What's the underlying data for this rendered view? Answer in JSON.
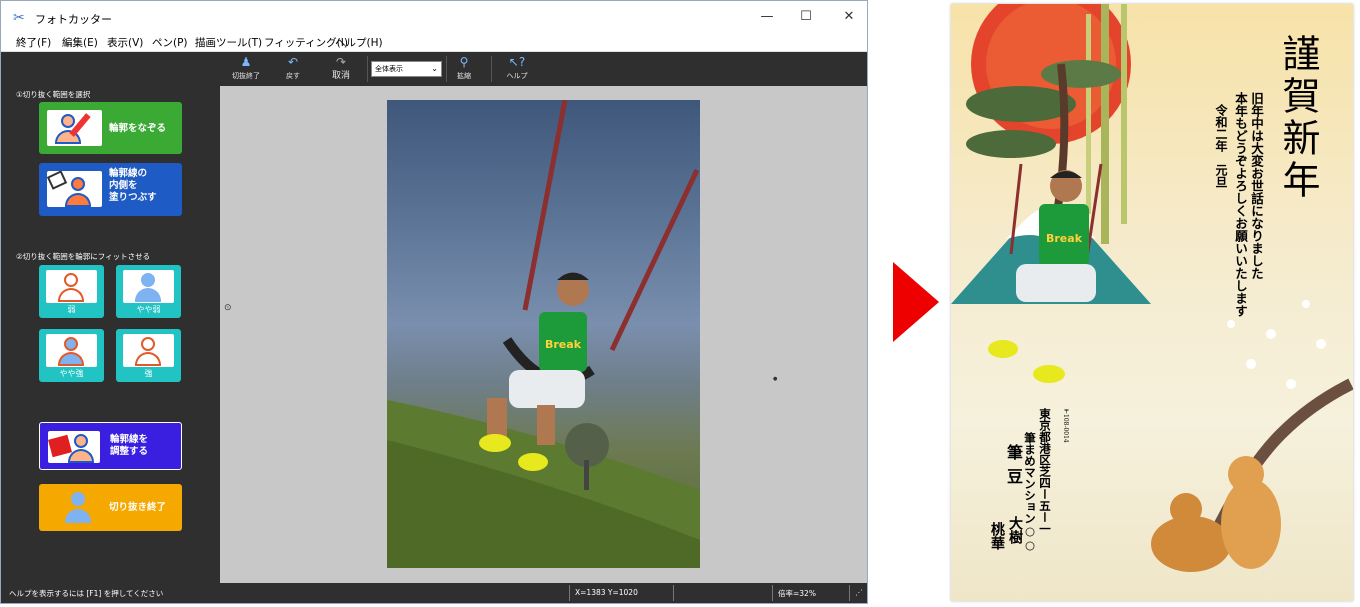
{
  "window": {
    "title": "フォトカッター",
    "controls": [
      "—",
      "☐",
      "✕"
    ]
  },
  "menu": [
    "終了(F)",
    "編集(E)",
    "表示(V)",
    "ペン(P)",
    "描画ツール(T)",
    "フィッティング(I)",
    "ヘルプ(H)"
  ],
  "toolbar": {
    "buttons": [
      {
        "label": "切抜終了",
        "icon": "person-cut-icon"
      },
      {
        "label": "戻す",
        "icon": "undo-icon"
      },
      {
        "label": "取消",
        "icon": "redo-icon"
      },
      {
        "label": "拡縮",
        "icon": "zoom-icon"
      },
      {
        "label": "ヘルプ",
        "icon": "help-icon"
      }
    ],
    "view_select": "全体表示"
  },
  "left_panel": {
    "section1": "①切り抜く範囲を選択",
    "trace_button": "輪郭をなぞる",
    "fill_button_lines": [
      "輪郭線の",
      "内側を",
      "塗りつぶす"
    ],
    "section2": "②切り抜く範囲を輪郭にフィットさせる",
    "fit_buttons": [
      "弱",
      "やや弱",
      "やや強",
      "強"
    ],
    "adjust_button_lines": [
      "輪郭線を",
      "調整する"
    ],
    "finish_button": "切り抜き終了"
  },
  "status": {
    "help_text": "ヘルプを表示するには [F1] を押してください",
    "coords": "X=1383 Y=1020",
    "zoom": "倍率=32%"
  },
  "card": {
    "greeting": "謹賀新年",
    "message_lines": [
      "旧年中は大変お世話になりました",
      "本年もどうぞよろしくお願いいたします"
    ],
    "date_line": "令和二年　元旦",
    "postal": "〒108-0014",
    "address": "東京都港区芝四ー五ー一",
    "building": "筆まめマンション○○",
    "family_name": "筆豆",
    "given_names": [
      "大",
      "樹"
    ],
    "given_names2": [
      "桃",
      "華"
    ],
    "shirt_text": "Break"
  },
  "colors": {
    "accent_green": "#3aaa35",
    "accent_blue": "#1f5bc4",
    "accent_teal": "#22c3c3",
    "accent_violet": "#3a1fe0",
    "accent_orange": "#f5a900",
    "arrow_red": "#ee0000"
  }
}
